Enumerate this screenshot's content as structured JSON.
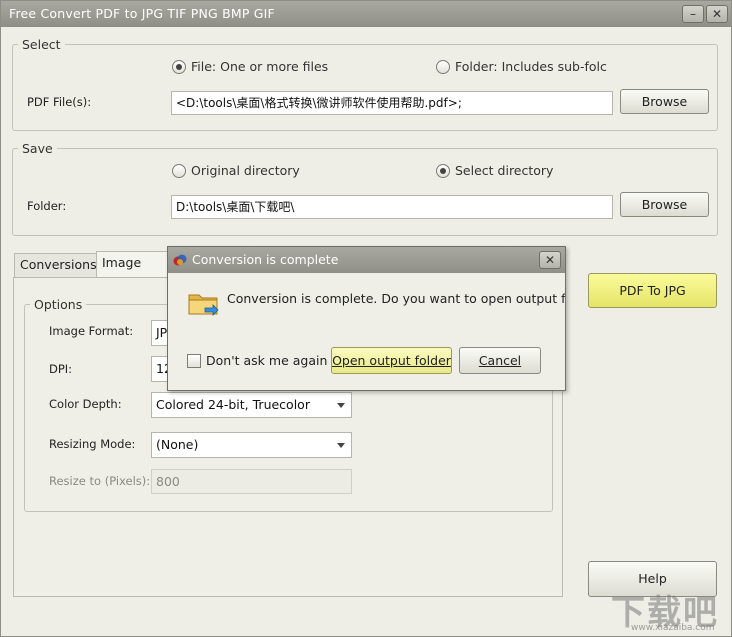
{
  "window": {
    "title": "Free Convert PDF to JPG TIF PNG BMP GIF",
    "minimize": "–",
    "close": "✕"
  },
  "select": {
    "legend": "Select",
    "file_radio": "File:  One or more files",
    "folder_radio": "Folder: Includes sub-folc",
    "pdf_files_label": "PDF File(s):",
    "pdf_files_value": "<D:\\tools\\桌面\\格式转换\\微讲师软件使用帮助.pdf>;",
    "browse": "Browse"
  },
  "save": {
    "legend": "Save",
    "original_radio": "Original directory",
    "select_radio": "Select directory",
    "folder_label": "Folder:",
    "folder_value": "D:\\tools\\桌面\\下载吧\\",
    "browse": "Browse"
  },
  "tabs": {
    "conversions": "Conversions",
    "image_options": "Image Opti"
  },
  "options": {
    "legend": "Options",
    "image_format_label": "Image Format:",
    "image_format_value": "JP",
    "dpi_label": "DPI:",
    "dpi_value": "12",
    "color_depth_label": "Color Depth:",
    "color_depth_value": "Colored 24-bit, Truecolor",
    "resizing_mode_label": "Resizing Mode:",
    "resizing_mode_value": "(None)",
    "resize_to_label": "Resize to (Pixels):",
    "resize_to_value": "800"
  },
  "actions": {
    "convert": "PDF To JPG",
    "help": "Help"
  },
  "dialog": {
    "title": "Conversion is complete",
    "message": "Conversion is complete. Do you want to open output fold",
    "dont_ask": "Don't ask me again",
    "open_folder": "Open output folder",
    "cancel": "Cancel",
    "close": "✕"
  },
  "watermark": {
    "text": "下载吧",
    "url": "www.xiazaiba.com"
  }
}
